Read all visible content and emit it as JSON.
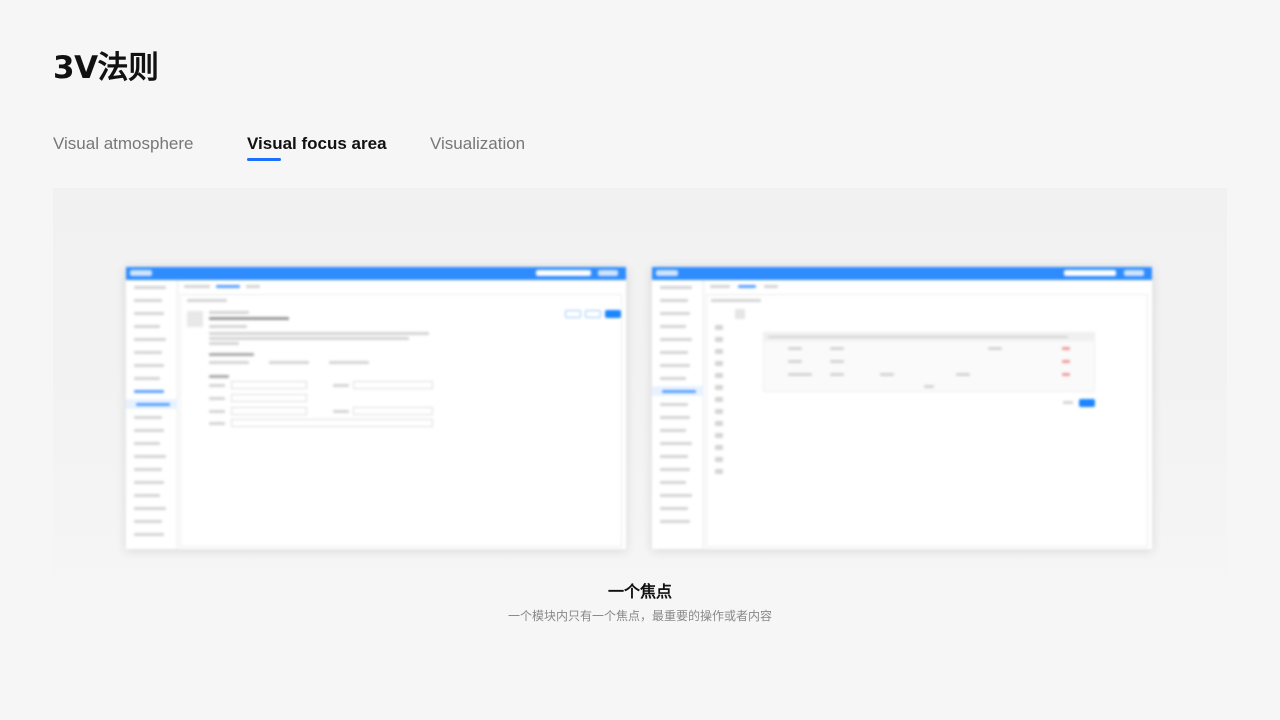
{
  "page": {
    "title": "3V法则"
  },
  "tabs": [
    {
      "label": "Visual atmosphere",
      "active": false
    },
    {
      "label": "Visual focus area",
      "active": true
    },
    {
      "label": "Visualization",
      "active": false
    }
  ],
  "colors": {
    "accent": "#1e6fff",
    "mock_header": "#2e8cff",
    "background": "#f6f6f6"
  },
  "caption": {
    "title": "一个焦点",
    "subtitle": "一个模块内只有一个焦点，最重要的操作或者内容"
  }
}
